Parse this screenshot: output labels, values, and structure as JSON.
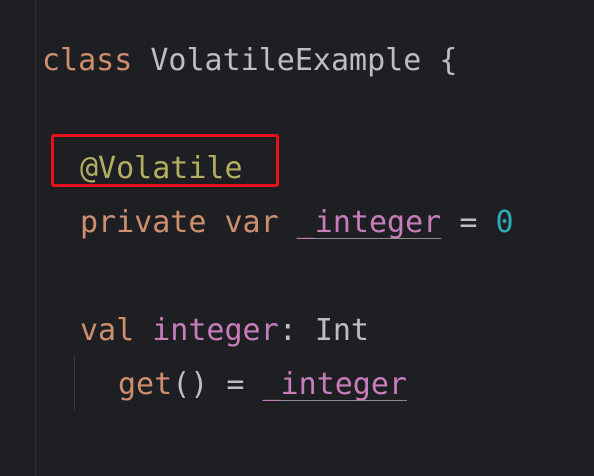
{
  "code": {
    "line1": {
      "keyword": "class",
      "name": "VolatileExample",
      "brace": "{"
    },
    "line2": {
      "annotation": "@Volatile"
    },
    "line3": {
      "keyword1": "private",
      "keyword2": "var",
      "prop": "_integer",
      "op": "=",
      "value": "0"
    },
    "line4": {
      "keyword": "val",
      "prop": "integer",
      "colon": ":",
      "type": "Int"
    },
    "line5": {
      "getter": "get",
      "parens": "()",
      "op": "=",
      "prop": "_integer"
    }
  },
  "highlight": {
    "color": "#e8101a",
    "target": "@Volatile"
  },
  "colors": {
    "background": "#1e1f22",
    "keyword": "#cf8e6d",
    "annotation": "#b3ae60",
    "property": "#c77dbb",
    "number": "#2aacb8",
    "text": "#bcbec4"
  }
}
